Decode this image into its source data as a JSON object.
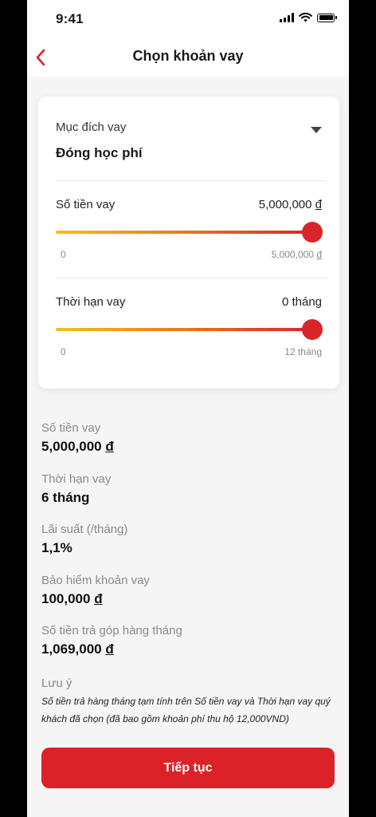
{
  "status_bar": {
    "time": "9:41"
  },
  "header": {
    "title": "Chọn khoản vay"
  },
  "purpose": {
    "label": "Mục đích vay",
    "value": "Đóng học phí"
  },
  "amount_slider": {
    "title": "Số tiền vay",
    "value": "5,000,000",
    "currency": "đ",
    "min_label": "0",
    "max_label": "5,000,000",
    "fill_fraction": 1.0
  },
  "term_slider": {
    "title": "Thời hạn vay",
    "value": "0 tháng",
    "min_label": "0",
    "max_label": "12 tháng",
    "fill_fraction": 1.0
  },
  "summary": [
    {
      "label": "Số tiền vay",
      "value": "5,000,000",
      "currency": "đ"
    },
    {
      "label": "Thời hạn vay",
      "value": "6 tháng",
      "currency": ""
    },
    {
      "label": "Lãi suất (/tháng)",
      "value": "1,1%",
      "currency": ""
    },
    {
      "label": "Bảo hiểm khoản vay",
      "value": "100,000",
      "currency": "đ"
    },
    {
      "label": "Số tiền trả góp hàng tháng",
      "value": "1,069,000",
      "currency": "đ"
    }
  ],
  "note": {
    "title": "Lưu ý",
    "text": "Số tiền trả hàng tháng  tạm tính trên Số tiền vay và Thời hạn vay quý khách đã chọn (đã bao gồm khoản phí thu hộ 12,000VND)"
  },
  "cta": {
    "label": "Tiếp tục"
  },
  "colors": {
    "accent": "#dc2229",
    "gradient_start": "#f2c21b",
    "gradient_end": "#d9252a"
  },
  "icons": {
    "back": "chevron-left-icon",
    "dropdown": "caret-down-icon"
  }
}
